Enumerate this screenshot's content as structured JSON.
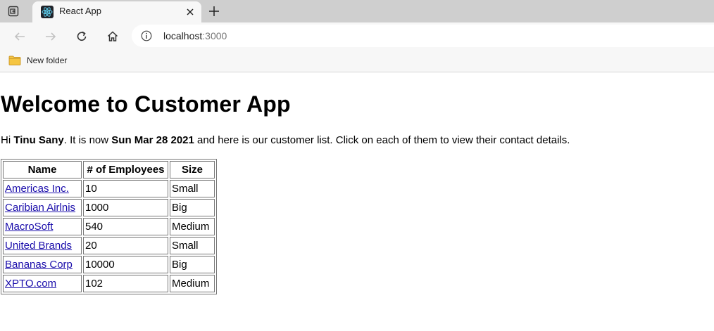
{
  "browser": {
    "tab_title": "React App",
    "url_host": "localhost",
    "url_port": ":3000",
    "bookmarks": [
      {
        "label": "New folder",
        "icon": "folder-icon"
      }
    ]
  },
  "page": {
    "title": "Welcome to Customer App",
    "intro": {
      "prefix": "Hi ",
      "user_name": "Tinu Sany",
      "middle": ". It is now ",
      "date": "Sun Mar 28 2021",
      "suffix": " and here is our customer list. Click on each of them to view their contact details."
    },
    "table": {
      "headers": [
        "Name",
        "# of Employees",
        "Size"
      ],
      "rows": [
        {
          "name": "Americas Inc.",
          "employees": "10",
          "size": "Small"
        },
        {
          "name": "Caribian Airlnis",
          "employees": "1000",
          "size": "Big"
        },
        {
          "name": "MacroSoft",
          "employees": "540",
          "size": "Medium"
        },
        {
          "name": "United Brands",
          "employees": "20",
          "size": "Small"
        },
        {
          "name": "Bananas Corp",
          "employees": "10000",
          "size": "Big"
        },
        {
          "name": "XPTO.com",
          "employees": "102",
          "size": "Medium"
        }
      ]
    }
  },
  "colors": {
    "link": "#1a0dab",
    "chrome_bg": "#f7f7f7",
    "tabstrip_bg": "#cfcfcf"
  }
}
